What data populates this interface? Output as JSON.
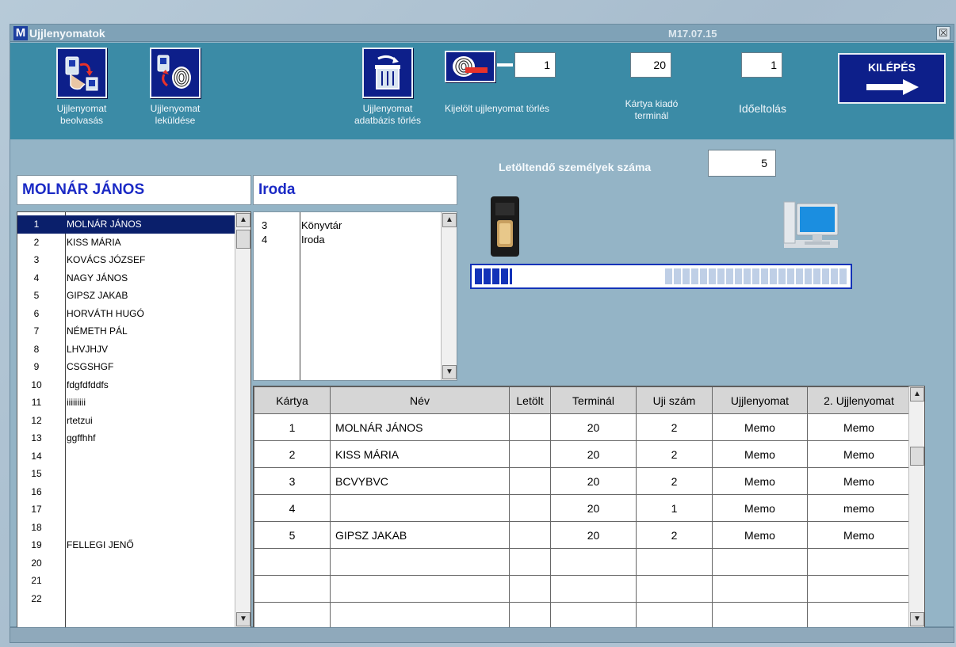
{
  "window": {
    "title": "Ujjlenyomatok",
    "logo_letter": "M",
    "version": "M17.07.15",
    "close_glyph": "☒"
  },
  "toolbar": {
    "read_label_1": "Ujjlenyomat",
    "read_label_2": "beolvasás",
    "send_label_1": "Ujjlenyomat",
    "send_label_2": "leküldése",
    "db_delete_label_1": "Ujjlenyomat",
    "db_delete_label_2": "adatbázis törlés",
    "selected_delete_label": "Kijelölt ujjlenyomat törlés",
    "selected_delete_value": "1",
    "card_terminal_value": "20",
    "card_terminal_label_1": "Kártya kiadó",
    "card_terminal_label_2": "terminál",
    "time_shift_value": "1",
    "time_shift_label": "Időeltolás",
    "exit_label": "KILÉPÉS"
  },
  "download": {
    "label": "Letöltendő személyek száma",
    "value": "5",
    "progress_fraction": 0.1
  },
  "selected_person": "MOLNÁR JÁNOS",
  "selected_office": "Iroda",
  "people": [
    {
      "num": "1",
      "name": "MOLNÁR JÁNOS",
      "selected": true
    },
    {
      "num": "2",
      "name": "KISS MÁRIA"
    },
    {
      "num": "3",
      "name": "KOVÁCS JÓZSEF"
    },
    {
      "num": "4",
      "name": "NAGY JÁNOS"
    },
    {
      "num": "5",
      "name": "GIPSZ JAKAB"
    },
    {
      "num": "6",
      "name": "HORVÁTH HUGÓ"
    },
    {
      "num": "7",
      "name": "NÉMETH PÁL"
    },
    {
      "num": "8",
      "name": "LHVJHJV"
    },
    {
      "num": "9",
      "name": "CSGSHGF"
    },
    {
      "num": "10",
      "name": "fdgfdfddfs"
    },
    {
      "num": "11",
      "name": "iiiiiiiii"
    },
    {
      "num": "12",
      "name": "rtetzui"
    },
    {
      "num": "13",
      "name": "ggffhhf"
    },
    {
      "num": "14",
      "name": ""
    },
    {
      "num": "15",
      "name": ""
    },
    {
      "num": "16",
      "name": ""
    },
    {
      "num": "17",
      "name": ""
    },
    {
      "num": "18",
      "name": ""
    },
    {
      "num": "19",
      "name": "FELLEGI JENŐ"
    },
    {
      "num": "20",
      "name": ""
    },
    {
      "num": "21",
      "name": ""
    },
    {
      "num": "22",
      "name": ""
    }
  ],
  "offices": [
    {
      "num": "3",
      "name": "Könyvtár"
    },
    {
      "num": "4",
      "name": "Iroda"
    }
  ],
  "grid": {
    "headers": [
      "Kártya",
      "Név",
      "Letölt",
      "Terminál",
      "Uji szám",
      "Ujjlenyomat",
      "2. Ujjlenyomat"
    ],
    "rows": [
      [
        "1",
        "MOLNÁR JÁNOS",
        "",
        "20",
        "2",
        "Memo",
        "Memo"
      ],
      [
        "2",
        "KISS MÁRIA",
        "",
        "20",
        "2",
        "Memo",
        "Memo"
      ],
      [
        "3",
        "BCVYBVC",
        "",
        "20",
        "2",
        "Memo",
        "Memo"
      ],
      [
        "4",
        "",
        "",
        "20",
        "1",
        "Memo",
        "memo"
      ],
      [
        "5",
        "GIPSZ JAKAB",
        "",
        "20",
        "2",
        "Memo",
        "Memo"
      ],
      [
        "",
        "",
        "",
        "",
        "",
        "",
        ""
      ],
      [
        "",
        "",
        "",
        "",
        "",
        "",
        ""
      ],
      [
        "",
        "",
        "",
        "",
        "",
        "",
        ""
      ]
    ]
  },
  "icons": {
    "read": "hand-to-reader-icon",
    "send": "fingerprint-send-icon",
    "db_delete": "trash-icon",
    "selected_delete": "fingerprint-delete-icon",
    "exit": "arrow-right-icon",
    "reader": "fingerprint-reader-icon",
    "pc": "computer-icon"
  },
  "colors": {
    "toolbar_bg": "#3b8ba6",
    "panel_bg": "#94b4c6",
    "button_bg": "#0d1f8a",
    "header_text": "#1b2ac5",
    "selection": "#0a1f6b"
  }
}
